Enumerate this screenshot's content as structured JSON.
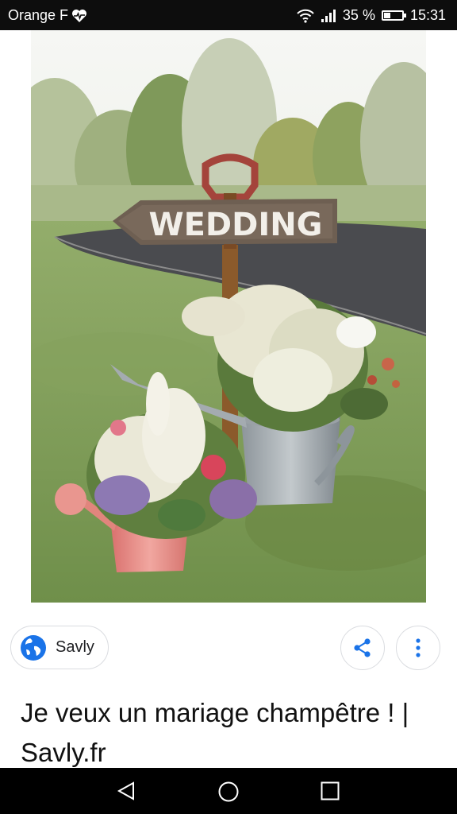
{
  "status_bar": {
    "carrier": "Orange F",
    "battery_percent": "35 %",
    "battery_level": 0.35,
    "time": "15:31",
    "icons": [
      "heart-pulse-icon",
      "wifi-icon",
      "signal-icon",
      "battery-icon"
    ]
  },
  "image": {
    "sign_text": "WEDDING"
  },
  "result": {
    "source_name": "Savly",
    "source_icon": "globe-icon",
    "title": "Je veux un mariage champêtre ! | Savly.fr"
  },
  "actions": {
    "share_icon": "share-icon",
    "more_icon": "more-vert-icon"
  },
  "nav_bar": {
    "icons": [
      "back-icon",
      "home-icon",
      "recents-icon"
    ]
  },
  "colors": {
    "status_bg": "#0d0d0d",
    "accent_blue": "#1a73e8",
    "nav_bg": "#000000"
  }
}
